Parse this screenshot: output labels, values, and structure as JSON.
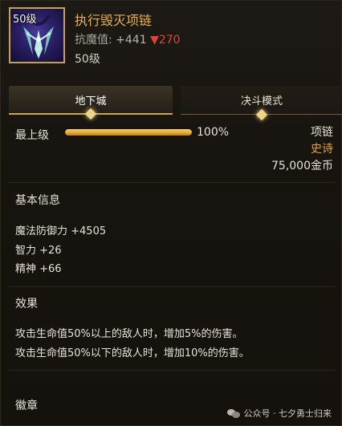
{
  "item": {
    "level_badge": "50级",
    "name": "执行毁灭项链",
    "resist_label": "抗魔值:",
    "resist_value": "+441",
    "resist_delta": "▼270",
    "level_req": "50级"
  },
  "tabs": [
    {
      "label": "地下城",
      "active": true
    },
    {
      "label": "决斗模式",
      "active": false
    }
  ],
  "upgrade": {
    "label": "最上级",
    "percent": 100,
    "percent_text": "100%"
  },
  "meta": {
    "slot": "项链",
    "rarity": "史诗",
    "price": "75,000金币"
  },
  "basic_info": {
    "title": "基本信息",
    "stats": [
      "魔法防御力 +4505",
      "智力 +26",
      "精神 +66"
    ]
  },
  "effect": {
    "title": "效果",
    "lines": [
      "攻击生命值50%以上的敌人时，增加5%的伤害。",
      "攻击生命值50%以下的敌人时，增加10%的伤害。"
    ]
  },
  "emblem": {
    "title": "徽章"
  },
  "watermark": {
    "text": "公众号 · 七夕勇士归来"
  },
  "colors": {
    "title_gold": "#e7b24a",
    "rarity_orange": "#e0a33c",
    "decrease_red": "#e0453a",
    "accent_gold": "#c9a650"
  }
}
